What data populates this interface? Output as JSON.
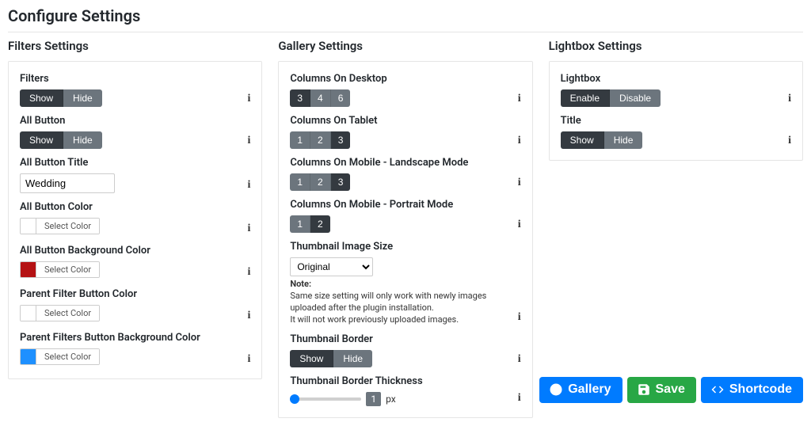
{
  "page": {
    "title": "Configure Settings"
  },
  "sections": {
    "filters": {
      "heading": "Filters Settings"
    },
    "gallery": {
      "heading": "Gallery Settings"
    },
    "lightbox": {
      "heading": "Lightbox Settings"
    }
  },
  "common": {
    "show": "Show",
    "hide": "Hide",
    "enable": "Enable",
    "disable": "Disable",
    "select_color": "Select Color"
  },
  "filters": {
    "filters_label": "Filters",
    "filters_value": "show",
    "all_button_label": "All Button",
    "all_button_value": "show",
    "all_button_title_label": "All Button Title",
    "all_button_title_value": "Wedding",
    "all_button_color_label": "All Button Color",
    "all_button_color_value": "#ffffff",
    "all_button_bg_label": "All Button Background Color",
    "all_button_bg_value": "#b51214",
    "parent_filter_color_label": "Parent Filter Button Color",
    "parent_filter_color_value": "#ffffff",
    "parent_filter_bg_label": "Parent Filters Button Background Color",
    "parent_filter_bg_value": "#1e90ff"
  },
  "gallery": {
    "cols_desktop_label": "Columns On Desktop",
    "cols_desktop_options": [
      "3",
      "4",
      "6"
    ],
    "cols_desktop_value": "3",
    "cols_tablet_label": "Columns On Tablet",
    "cols_tablet_options": [
      "1",
      "2",
      "3"
    ],
    "cols_tablet_value": "3",
    "cols_mobile_land_label": "Columns On Mobile - Landscape Mode",
    "cols_mobile_land_options": [
      "1",
      "2",
      "3"
    ],
    "cols_mobile_land_value": "3",
    "cols_mobile_port_label": "Columns On Mobile - Portrait Mode",
    "cols_mobile_port_options": [
      "1",
      "2"
    ],
    "cols_mobile_port_value": "2",
    "thumb_size_label": "Thumbnail Image Size",
    "thumb_size_value": "Original",
    "thumb_size_options": [
      "Original"
    ],
    "note_title": "Note:",
    "note_line1": "Same size setting will only work with newly images uploaded after the plugin installation.",
    "note_line2": "It will not work previously uploaded images.",
    "thumb_border_label": "Thumbnail Border",
    "thumb_border_value": "show",
    "thumb_border_thickness_label": "Thumbnail Border Thickness",
    "thumb_border_thickness_value": "1",
    "thumb_border_thickness_unit": "px"
  },
  "lightbox": {
    "lightbox_label": "Lightbox",
    "lightbox_value": "enable",
    "title_label": "Title",
    "title_value": "show"
  },
  "actions": {
    "gallery": "Gallery",
    "save": "Save",
    "shortcode": "Shortcode"
  }
}
